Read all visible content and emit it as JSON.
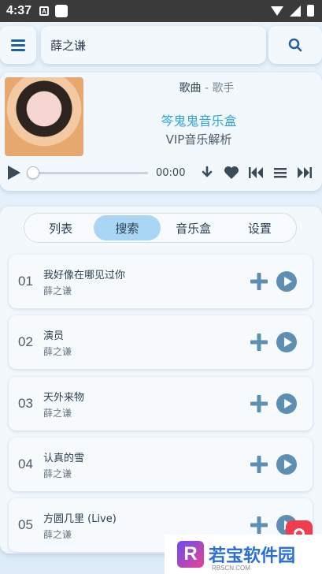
{
  "status_bar": {
    "time": "4:37",
    "mini_icon": "A"
  },
  "search": {
    "query": "薛之谦"
  },
  "player": {
    "song_label": "歌曲",
    "separator": " - ",
    "artist_label": "歌手",
    "app_name": "笒鬼鬼音乐盒",
    "subtitle": "VIP音乐解析",
    "current_time": "00:00",
    "progress": 0
  },
  "tabs": [
    {
      "label": "列表",
      "active": false
    },
    {
      "label": "搜索",
      "active": true
    },
    {
      "label": "音乐盒",
      "active": false
    },
    {
      "label": "设置",
      "active": false
    }
  ],
  "results": [
    {
      "num": "01",
      "title": "我好像在哪见过你",
      "artist": "薛之谦"
    },
    {
      "num": "02",
      "title": "演员",
      "artist": "薛之谦"
    },
    {
      "num": "03",
      "title": "天外来物",
      "artist": "薛之谦"
    },
    {
      "num": "04",
      "title": "认真的雪",
      "artist": "薛之谦"
    },
    {
      "num": "05",
      "title": "方圆几里 (Live)",
      "artist": "薛之谦"
    }
  ],
  "watermark": {
    "logo_letter": "R",
    "text": "若宝软件园",
    "sub": "RBSCN.COM"
  },
  "colors": {
    "accent": "#2fa5e0",
    "tab_active": "#a9d6f5",
    "icon": "#5d8fb2"
  }
}
